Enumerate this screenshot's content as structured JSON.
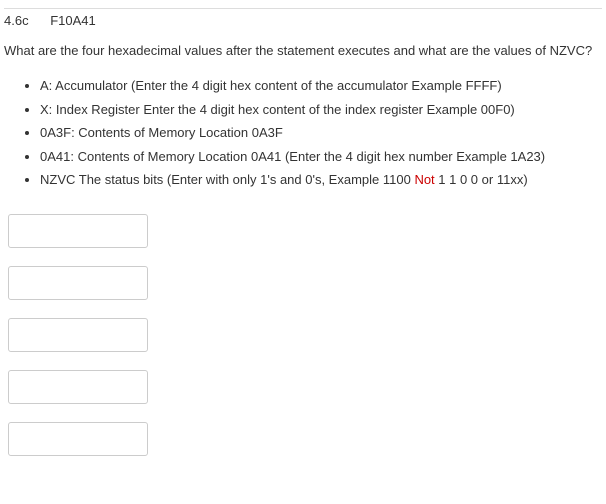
{
  "header": {
    "section": "4.6c",
    "code": "F10A41"
  },
  "question": "What are the four hexadecimal values after the statement executes and what are the values of NZVC?",
  "instructions": [
    {
      "text": "A: Accumulator  (Enter the 4 digit  hex content of the accumulator  Example   FFFF)"
    },
    {
      "text": "X: Index Register  Enter the 4 digit hex content of the index register  Example 00F0)"
    },
    {
      "text": "0A3F: Contents of Memory Location 0A3F"
    },
    {
      "text": "0A41: Contents of Memory Location 0A41  (Enter the 4 digit hex number  Example  1A23)"
    },
    {
      "prefix": "NZVC The status bits (Enter with only 1's and 0's, Example 1100 ",
      "red": "Not",
      "suffix": " 1 1 0 0 or 11xx)"
    }
  ],
  "inputs": {
    "a": "",
    "x": "",
    "m0a3f": "",
    "m0a41": "",
    "nzvc": ""
  }
}
